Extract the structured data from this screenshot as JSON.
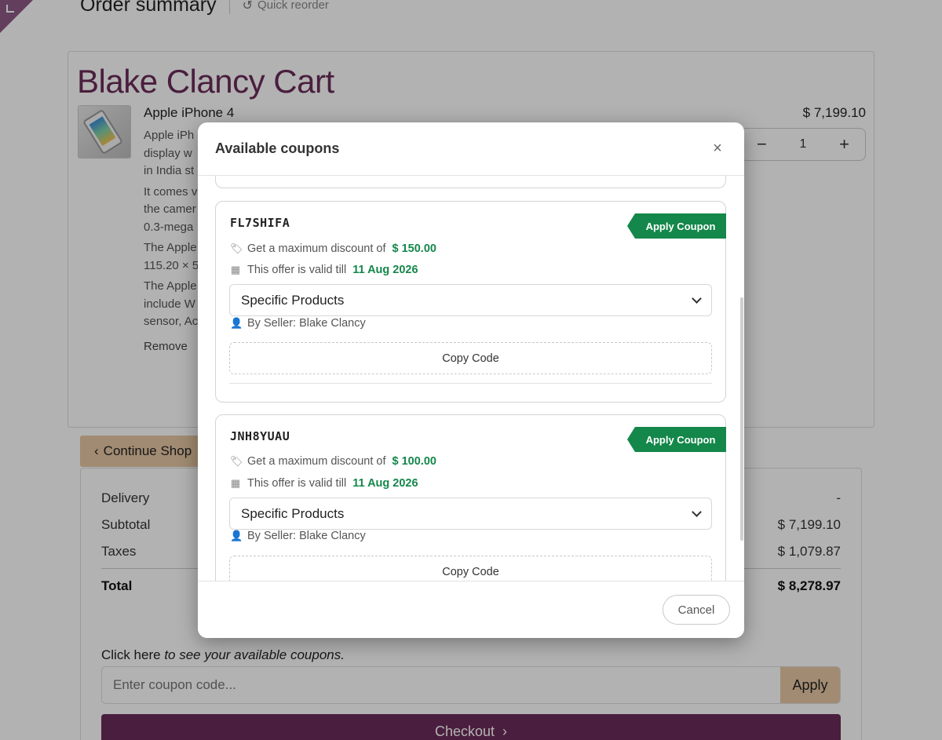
{
  "header": {
    "title": "Order summary",
    "quick_reorder": "Quick reorder"
  },
  "cart": {
    "title": "Blake Clancy Cart",
    "product": {
      "name": "Apple iPhone 4",
      "price": "$ 7,199.10",
      "description": [
        [
          "Apple iPh",
          "display w",
          "in India st"
        ],
        [
          "It comes v",
          "the camer",
          "0.3-mega"
        ],
        [
          "The Apple",
          "115.20 × 5"
        ],
        [
          "The Apple",
          "include W",
          "sensor, Ac"
        ]
      ],
      "quantity": "1",
      "remove_label": "Remove"
    }
  },
  "continue_label": "Continue Shop",
  "summary": {
    "delivery_label": "Delivery",
    "delivery_value": "-",
    "subtotal_label": "Subtotal",
    "subtotal_value": "$ 7,199.10",
    "taxes_label": "Taxes",
    "taxes_value": "$ 1,079.87",
    "total_label": "Total",
    "total_value": "$ 8,278.97",
    "coupon_hint_prefix": "Click here",
    "coupon_hint_suffix": "to see your available coupons.",
    "coupon_placeholder": "Enter coupon code...",
    "apply_label": "Apply",
    "checkout_label": "Checkout"
  },
  "modal": {
    "title": "Available coupons",
    "close": "×",
    "coupons": [
      {
        "code": "FL7SHIFA",
        "apply_label": "Apply Coupon",
        "discount_prefix": "Get a maximum discount of",
        "discount_value": "$ 150.00",
        "valid_prefix": "This offer is valid till",
        "valid_date": "11 Aug 2026",
        "scope": "Specific Products",
        "seller": "By Seller: Blake Clancy",
        "copy_label": "Copy Code"
      },
      {
        "code": "JNH8YUAU",
        "apply_label": "Apply Coupon",
        "discount_prefix": "Get a maximum discount of",
        "discount_value": "$ 100.00",
        "valid_prefix": "This offer is valid till",
        "valid_date": "11 Aug 2026",
        "scope": "Specific Products",
        "seller": "By Seller: Blake Clancy",
        "copy_label": "Copy Code"
      }
    ],
    "cancel_label": "Cancel"
  },
  "colors": {
    "brand": "#6b2b5a",
    "accent": "#e7c7a4",
    "success": "#14874a"
  }
}
